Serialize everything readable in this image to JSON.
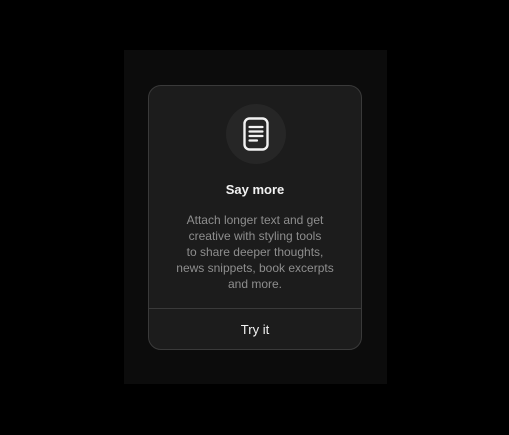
{
  "dialog": {
    "icon": "text-document-icon",
    "title": "Say more",
    "description_lines": [
      "Attach longer text and get",
      "creative with styling tools",
      "to share deeper thoughts,",
      "news snippets, book excerpts",
      "and more."
    ],
    "action_label": "Try it"
  },
  "colors": {
    "background": "#000000",
    "dialog_background": "#1c1c1c",
    "border": "#3a3a3a",
    "title_text": "#f2f2f2",
    "description_text": "#8e8e8e"
  }
}
